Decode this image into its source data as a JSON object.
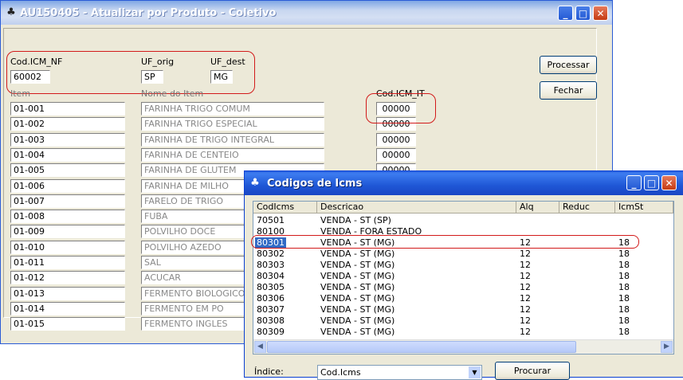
{
  "main_window": {
    "title": "AU150405 - Atualizar por Produto - Coletivo",
    "controls": {
      "minimize": "_",
      "maximize": "□",
      "close": "✕"
    },
    "header": {
      "cod_icm_nf_label": "Cod.ICM_NF",
      "cod_icm_nf_value": "60002",
      "uf_orig_label": "UF_orig",
      "uf_orig_value": "SP",
      "uf_dest_label": "UF_dest",
      "uf_dest_value": "MG"
    },
    "columns": {
      "item": "Item",
      "nome": "Nome do Item",
      "cod_icm_it": "Cod.ICM_IT"
    },
    "rows": [
      {
        "item": "01-001",
        "nome": "FARINHA TRIGO COMUM",
        "cod": "00000"
      },
      {
        "item": "01-002",
        "nome": "FARINHA TRIGO ESPECIAL",
        "cod": "00000"
      },
      {
        "item": "01-003",
        "nome": "FARINHA DE TRIGO INTEGRAL",
        "cod": "00000"
      },
      {
        "item": "01-004",
        "nome": "FARINHA DE CENTEIO",
        "cod": "00000"
      },
      {
        "item": "01-005",
        "nome": "FARINHA DE GLUTEM",
        "cod": "00000"
      },
      {
        "item": "01-006",
        "nome": "FARINHA DE MILHO",
        "cod": ""
      },
      {
        "item": "01-007",
        "nome": "FARELO DE TRIGO",
        "cod": ""
      },
      {
        "item": "01-008",
        "nome": "FUBA",
        "cod": ""
      },
      {
        "item": "01-009",
        "nome": "POLVILHO DOCE",
        "cod": ""
      },
      {
        "item": "01-010",
        "nome": "POLVILHO AZEDO",
        "cod": ""
      },
      {
        "item": "01-011",
        "nome": "SAL",
        "cod": ""
      },
      {
        "item": "01-012",
        "nome": "ACUCAR",
        "cod": ""
      },
      {
        "item": "01-013",
        "nome": "FERMENTO BIOLOGICO",
        "cod": ""
      },
      {
        "item": "01-014",
        "nome": "FERMENTO EM PO",
        "cod": ""
      },
      {
        "item": "01-015",
        "nome": "FERMENTO INGLES",
        "cod": ""
      }
    ],
    "buttons": {
      "processar": "Processar",
      "fechar": "Fechar"
    }
  },
  "dialog": {
    "title": "Codigos de Icms",
    "controls": {
      "minimize": "_",
      "maximize": "□",
      "close": "✕"
    },
    "columns": {
      "codicms": "CodIcms",
      "descricao": "Descricao",
      "alq": "Alq",
      "reduc": "Reduc",
      "icmst": "IcmSt"
    },
    "rows": [
      {
        "cod": "70501",
        "desc": "VENDA - ST (SP)",
        "alq": "",
        "reduc": "",
        "icmst": ""
      },
      {
        "cod": "80100",
        "desc": "VENDA - FORA ESTADO",
        "alq": "",
        "reduc": "",
        "icmst": ""
      },
      {
        "cod": "80301",
        "desc": "VENDA - ST (MG)",
        "alq": "12",
        "reduc": "",
        "icmst": "18"
      },
      {
        "cod": "80302",
        "desc": "VENDA - ST (MG)",
        "alq": "12",
        "reduc": "",
        "icmst": "18"
      },
      {
        "cod": "80303",
        "desc": "VENDA - ST (MG)",
        "alq": "12",
        "reduc": "",
        "icmst": "18"
      },
      {
        "cod": "80304",
        "desc": "VENDA - ST (MG)",
        "alq": "12",
        "reduc": "",
        "icmst": "18"
      },
      {
        "cod": "80305",
        "desc": "VENDA - ST (MG)",
        "alq": "12",
        "reduc": "",
        "icmst": "18"
      },
      {
        "cod": "80306",
        "desc": "VENDA - ST (MG)",
        "alq": "12",
        "reduc": "",
        "icmst": "18"
      },
      {
        "cod": "80307",
        "desc": "VENDA - ST (MG)",
        "alq": "12",
        "reduc": "",
        "icmst": "18"
      },
      {
        "cod": "80308",
        "desc": "VENDA - ST (MG)",
        "alq": "12",
        "reduc": "",
        "icmst": "18"
      },
      {
        "cod": "80309",
        "desc": "VENDA - ST (MG)",
        "alq": "12",
        "reduc": "",
        "icmst": "18"
      }
    ],
    "selected_index": 2,
    "indice_label": "Índice:",
    "indice_value": "Cod.Icms",
    "procurar": "Procurar"
  },
  "colors": {
    "highlight": "#d21a1a",
    "selection": "#316ac5",
    "title_active": "#1f57d6",
    "title_inactive": "#9db4e6"
  }
}
